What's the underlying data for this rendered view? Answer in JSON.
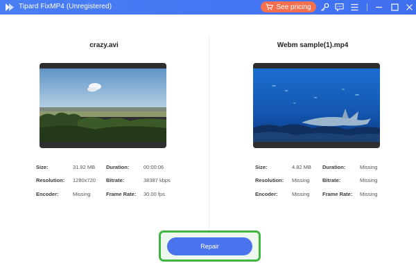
{
  "app": {
    "title": "Tipard FixMP4 (Unregistered)",
    "pricing_label": "See pricing",
    "accent_color": "#4a7ef4",
    "pricing_color": "#f4704f"
  },
  "toolbar_icons": [
    "key-icon",
    "feedback-icon",
    "menu-icon",
    "minimize-icon",
    "maximize-icon",
    "close-icon"
  ],
  "left": {
    "file_name": "crazy.avi",
    "thumbnail": "landscape-sky-trees",
    "size_label": "Size:",
    "size": "31.92 MB",
    "duration_label": "Duration:",
    "duration": "00:00:06",
    "resolution_label": "Resolution:",
    "resolution": "1280x720",
    "bitrate_label": "Bitrate:",
    "bitrate": "38387 kbps",
    "encoder_label": "Encoder:",
    "encoder": "Missing",
    "framerate_label": "Frame Rate:",
    "framerate": "30.00 fps"
  },
  "right": {
    "file_name": "Webm sample(1).mp4",
    "thumbnail": "underwater-shark",
    "size_label": "Size:",
    "size": "4.82 MB",
    "duration_label": "Duration:",
    "duration": "Missing",
    "resolution_label": "Resolution:",
    "resolution": "Missing",
    "bitrate_label": "Bitrate:",
    "bitrate": "Missing",
    "encoder_label": "Encoder:",
    "encoder": "Missing",
    "framerate_label": "Frame Rate:",
    "framerate": "Missing"
  },
  "repair": {
    "label": "Repair",
    "button_color": "#4a73ee",
    "highlight_color": "#3db63d"
  }
}
